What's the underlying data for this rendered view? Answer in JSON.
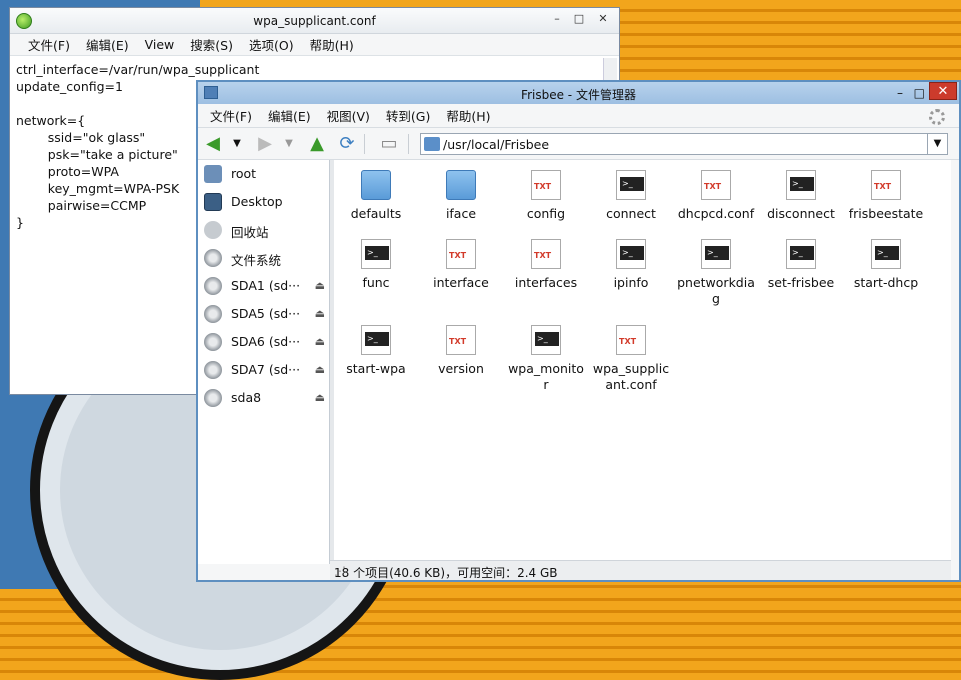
{
  "editor": {
    "title": "wpa_supplicant.conf",
    "minimize": "–",
    "maximize": "□",
    "close": "✕",
    "menu": [
      "文件(F)",
      "编辑(E)",
      "View",
      "搜索(S)",
      "选项(O)",
      "帮助(H)"
    ],
    "lines": [
      "ctrl_interface=/var/run/wpa_supplicant",
      "update_config=1",
      "",
      "network={",
      "        ssid=\"ok glass\"",
      "        psk=\"take a picture\"",
      "        proto=WPA",
      "        key_mgmt=WPA-PSK",
      "        pairwise=CCMP",
      "}"
    ]
  },
  "file_manager": {
    "title": "Frisbee - 文件管理器",
    "minimize": "–",
    "maximize": "□",
    "close": "✕",
    "menu": [
      "文件(F)",
      "编辑(E)",
      "视图(V)",
      "转到(G)",
      "帮助(H)"
    ],
    "address": "/usr/local/Frisbee",
    "sidebar": [
      {
        "label": "root",
        "icon": "home-icon"
      },
      {
        "label": "Desktop",
        "icon": "desktop-icon"
      },
      {
        "label": "回收站",
        "icon": "trash-icon"
      },
      {
        "label": "文件系统",
        "icon": "disk-icon"
      },
      {
        "label": "SDA1 (sd···",
        "icon": "disk-icon",
        "eject": "⏏"
      },
      {
        "label": "SDA5 (sd···",
        "icon": "disk-icon",
        "eject": "⏏"
      },
      {
        "label": "SDA6 (sd···",
        "icon": "disk-icon",
        "eject": "⏏"
      },
      {
        "label": "SDA7 (sd···",
        "icon": "disk-icon",
        "eject": "⏏"
      },
      {
        "label": "sda8",
        "icon": "disk-icon",
        "eject": "⏏"
      }
    ],
    "files": [
      {
        "name": "defaults",
        "type": "folder"
      },
      {
        "name": "iface",
        "type": "folder"
      },
      {
        "name": "config",
        "type": "txt"
      },
      {
        "name": "connect",
        "type": "term"
      },
      {
        "name": "dhcpcd.conf",
        "type": "txt"
      },
      {
        "name": "disconnect",
        "type": "term"
      },
      {
        "name": "frisbeestate",
        "type": "txt"
      },
      {
        "name": "func",
        "type": "term"
      },
      {
        "name": "interface",
        "type": "txt"
      },
      {
        "name": "interfaces",
        "type": "txt"
      },
      {
        "name": "ipinfo",
        "type": "term"
      },
      {
        "name": "pnetworkdiag",
        "type": "term"
      },
      {
        "name": "set-frisbee",
        "type": "term"
      },
      {
        "name": "start-dhcp",
        "type": "term"
      },
      {
        "name": "start-wpa",
        "type": "term"
      },
      {
        "name": "version",
        "type": "txt"
      },
      {
        "name": "wpa_monitor",
        "type": "term"
      },
      {
        "name": "wpa_supplicant.conf",
        "type": "txt"
      }
    ],
    "status": "18 个项目(40.6 KB)，可用空间：2.4 GB"
  }
}
